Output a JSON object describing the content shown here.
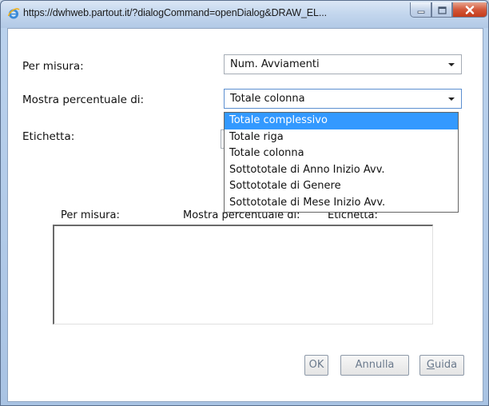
{
  "window": {
    "title": "https://dwhweb.partout.it/?dialogCommand=openDialog&DRAW_EL...",
    "icon": "ie-icon"
  },
  "form": {
    "measure_label": "Per misura:",
    "measure_value": "Num. Avviamenti",
    "percent_label": "Mostra percentuale di:",
    "percent_value": "Totale colonna",
    "tag_label": "Etichetta:"
  },
  "dropdown": {
    "options": [
      "Totale complessivo",
      "Totale riga",
      "Totale colonna",
      "Sottototale di Anno Inizio Avv.",
      "Sottototale di Genere",
      "Sottototale di Mese Inizio Avv."
    ],
    "highlighted_index": 0
  },
  "table": {
    "columns": [
      "Per misura:",
      "Mostra percentuale di:",
      "Etichetta:"
    ]
  },
  "buttons": {
    "ok": "OK",
    "cancel": "Annulla",
    "help_underlined": "G",
    "help_rest": "uida"
  },
  "colors": {
    "highlight": "#3399ff",
    "close_button": "#c43b1a",
    "title_bar": "#c4d7ee"
  }
}
